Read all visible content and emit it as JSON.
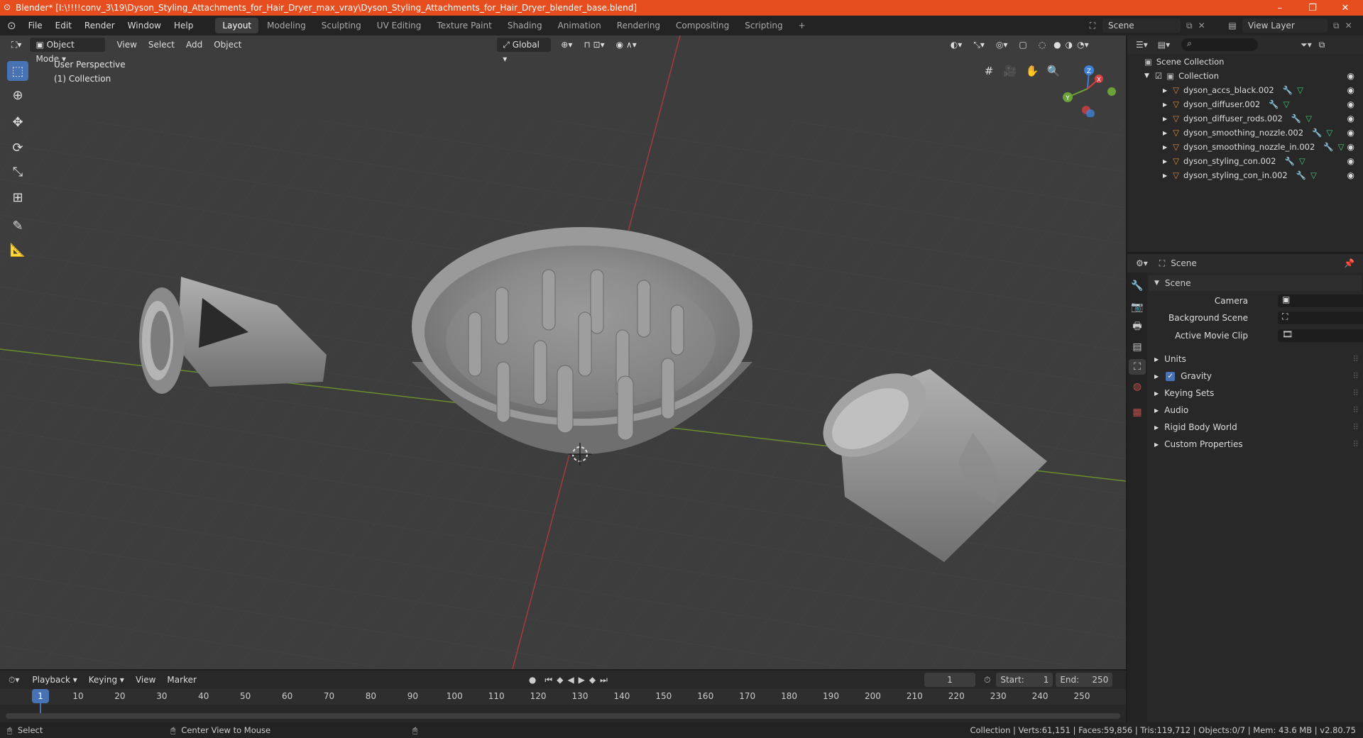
{
  "title": "Blender* [I:\\!!!!conv_3\\19\\Dyson_Styling_Attachments_for_Hair_Dryer_max_vray\\Dyson_Styling_Attachments_for_Hair_Dryer_blender_base.blend]",
  "window_controls": {
    "minimize": "–",
    "maximize": "❐",
    "close": "✕"
  },
  "menu": [
    "File",
    "Edit",
    "Render",
    "Window",
    "Help"
  ],
  "workspaces": [
    "Layout",
    "Modeling",
    "Sculpting",
    "UV Editing",
    "Texture Paint",
    "Shading",
    "Animation",
    "Rendering",
    "Compositing",
    "Scripting"
  ],
  "add_workspace": "+",
  "scene_selector": "Scene",
  "view_layer": "View Layer",
  "viewport": {
    "mode": "Object Mode",
    "menus": [
      "View",
      "Select",
      "Add",
      "Object"
    ],
    "transform_orientation": "Global",
    "perspective_label": "User Perspective",
    "collection_label": "(1) Collection",
    "gizmo": {
      "x": "X",
      "y": "Y",
      "z": "Z"
    }
  },
  "outliner": {
    "root": "Scene Collection",
    "collection": "Collection",
    "objects": [
      "dyson_accs_black.002",
      "dyson_diffuser.002",
      "dyson_diffuser_rods.002",
      "dyson_smoothing_nozzle.002",
      "dyson_smoothing_nozzle_in.002",
      "dyson_styling_con.002",
      "dyson_styling_con_in.002"
    ]
  },
  "properties": {
    "header": "Scene",
    "panel": "Scene",
    "fields": [
      {
        "label": "Camera"
      },
      {
        "label": "Background Scene"
      },
      {
        "label": "Active Movie Clip"
      }
    ],
    "sections": [
      "Units",
      "Gravity",
      "Keying Sets",
      "Audio",
      "Rigid Body World",
      "Custom Properties"
    ]
  },
  "timeline": {
    "menus": [
      "Playback",
      "Keying",
      "View",
      "Marker"
    ],
    "current_frame": "1",
    "start_label": "Start:",
    "start": "1",
    "end_label": "End:",
    "end": "250",
    "ticks": [
      "1",
      "10",
      "20",
      "30",
      "40",
      "50",
      "60",
      "70",
      "80",
      "90",
      "100",
      "110",
      "120",
      "130",
      "140",
      "150",
      "160",
      "170",
      "180",
      "190",
      "200",
      "210",
      "220",
      "230",
      "240",
      "250"
    ]
  },
  "statusbar": {
    "select": "Select",
    "center": "Center View to Mouse",
    "stats": "Collection | Verts:61,151 | Faces:59,856 | Tris:119,712 | Objects:0/7 | Mem: 43.6 MB | v2.80.75"
  },
  "colors": {
    "title_bg": "#e64d1f",
    "viewport_bg": "#3d3d3d",
    "panel_bg": "#282828",
    "accent": "#4772b3",
    "object_icon": "#e0883a"
  }
}
